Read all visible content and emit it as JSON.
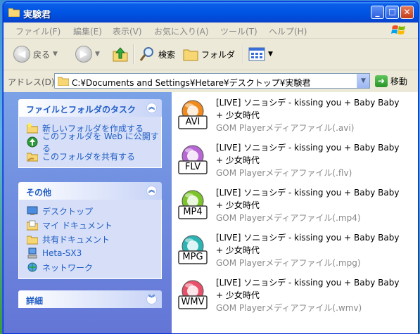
{
  "window": {
    "title": "実験君",
    "buttons": {
      "min": "_",
      "max": "□",
      "close": "✕"
    }
  },
  "menu": [
    "ファイル(F)",
    "編集(E)",
    "表示(V)",
    "お気に入り(A)",
    "ツール(T)",
    "ヘルプ(H)"
  ],
  "toolbar": {
    "back_label": "戻る",
    "search_label": "検索",
    "folder_label": "フォルダ"
  },
  "address": {
    "label": "アドレス(D)",
    "value": "C:¥Documents and Settings¥Hetare¥デスクトップ¥実験君",
    "go_label": "移動"
  },
  "panels": {
    "tasks": {
      "title": "ファイルとフォルダのタスク",
      "items": [
        "新しいフォルダを作成する",
        "このフォルダを Web に公開する",
        "このフォルダを共有する"
      ]
    },
    "other": {
      "title": "その他",
      "items": [
        "デスクトップ",
        "マイ ドキュメント",
        "共有ドキュメント",
        "Heta-SX3",
        "ネットワーク"
      ]
    },
    "details": {
      "title": "詳細"
    }
  },
  "files": [
    {
      "name": "[LIVE] ソニョシデ - kissing you + Baby Baby + 少女時代",
      "type": "GOM Playerメディアファイル(.avi)",
      "badge": "AVI",
      "color": "#f08a1c"
    },
    {
      "name": "[LIVE] ソニョシデ - kissing you + Baby Baby + 少女時代",
      "type": "GOM Playerメディアファイル(.flv)",
      "badge": "FLV",
      "color": "#b866d6"
    },
    {
      "name": "[LIVE] ソニョシデ - kissing you + Baby Baby + 少女時代",
      "type": "GOM Playerメディアファイル(.mp4)",
      "badge": "MP4",
      "color": "#7cc42a"
    },
    {
      "name": "[LIVE] ソニョシデ - kissing you + Baby Baby + 少女時代",
      "type": "GOM Playerメディアファイル(.mpg)",
      "badge": "MPG",
      "color": "#2bb4b4"
    },
    {
      "name": "[LIVE] ソニョシデ - kissing you + Baby Baby + 少女時代",
      "type": "GOM Playerメディアファイル(.wmv)",
      "badge": "WMV",
      "color": "#e8506a"
    }
  ]
}
